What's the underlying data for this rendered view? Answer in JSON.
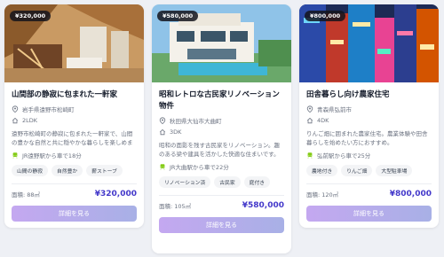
{
  "colors": {
    "accent": "#4338ca",
    "button_start": "#c4a8f0",
    "button_end": "#a8b0e6"
  },
  "cards": [
    {
      "price_badge": "¥320,000",
      "title": "山間部の静寂に包まれた一軒家",
      "location": "岩手県遠野市松崎町",
      "layout": "2LDK",
      "description": "遠野市松崎町の静寂に包まれた一軒家で、山間の豊かな自然と共に穏やかな暮らしを楽しめます。",
      "transit": "JR遠野駅から車で18分",
      "tags": [
        "山間の静寂",
        "自然豊か",
        "薪ストーブ"
      ],
      "area": "面積: 88㎡",
      "price": "¥320,000",
      "button": "詳細を見る"
    },
    {
      "price_badge": "¥580,000",
      "title": "昭和レトロな古民家リノベーション物件",
      "location": "秋田県大仙市大曲町",
      "layout": "3DK",
      "description": "昭和の面影を残す古民家をリノベーション。趣のある梁や建具を活かした快適な住まいです。",
      "transit": "JR大曲駅から車で22分",
      "tags": [
        "リノベーション済",
        "古民家",
        "庭付き"
      ],
      "area": "面積: 105㎡",
      "price": "¥580,000",
      "button": "詳細を見る"
    },
    {
      "price_badge": "¥800,000",
      "title": "田舎暮らし向け農家住宅",
      "location": "青森県弘前市",
      "layout": "4DK",
      "description": "りんご畑に囲まれた農家住宅。農業体験や田舎暮らしを始めたい方におすすめ。",
      "transit": "弘前駅から車で25分",
      "tags": [
        "農地付き",
        "りんご畑",
        "大型駐車場"
      ],
      "area": "面積: 120㎡",
      "price": "¥800,000",
      "button": "詳細を見る"
    }
  ]
}
